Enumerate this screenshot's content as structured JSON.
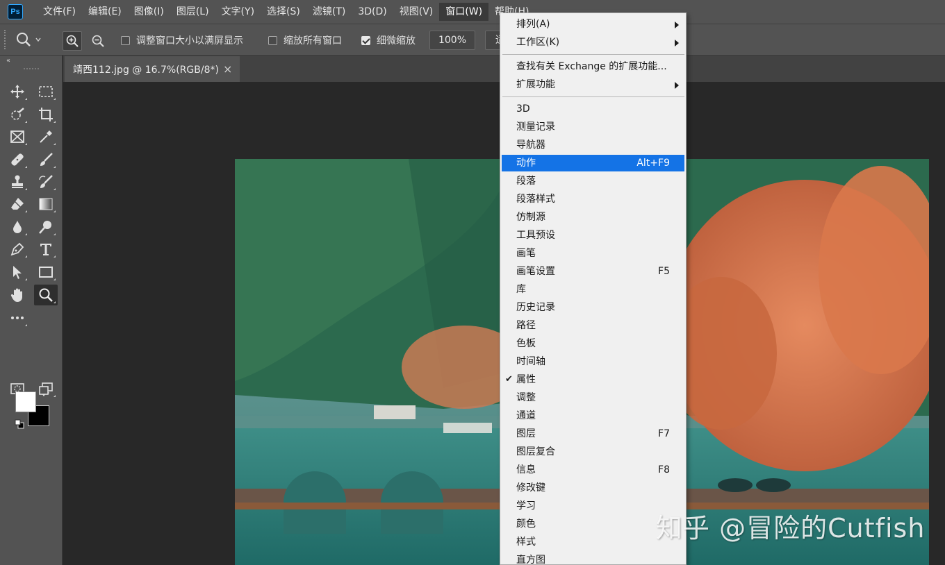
{
  "app": {
    "logo": "Ps"
  },
  "menubar": {
    "items": [
      "文件(F)",
      "编辑(E)",
      "图像(I)",
      "图层(L)",
      "文字(Y)",
      "选择(S)",
      "滤镜(T)",
      "3D(D)",
      "视图(V)",
      "窗口(W)",
      "帮助(H)"
    ],
    "active": "窗口(W)"
  },
  "options": {
    "fit_screen_label": "调整窗口大小以满屏显示",
    "zoom_all_label": "缩放所有窗口",
    "scrubby_label": "细微缩放",
    "scrubby_checked": true,
    "fit_screen_checked": false,
    "zoom_all_checked": false,
    "zoom_value": "100%",
    "next_button_partial": "适"
  },
  "toolbar": {
    "collapse_glyph": "‹‹",
    "tools": [
      "move-tool",
      "marquee-tool",
      "lasso-tool",
      "crop-tool",
      "frame-tool",
      "eyedropper-tool",
      "healing-tool",
      "brush-tool",
      "stamp-tool",
      "history-brush-tool",
      "eraser-tool",
      "gradient-tool",
      "blur-tool",
      "dodge-tool",
      "pen-tool",
      "type-tool",
      "path-select-tool",
      "rectangle-tool",
      "hand-tool",
      "zoom-tool",
      "more-tools",
      "quick-mask",
      "screen-mode"
    ],
    "selected_tool": "zoom-tool",
    "foreground_color": "#ffffff",
    "background_color": "#000000"
  },
  "document": {
    "tab_title": "靖西112.jpg @ 16.7%(RGB/8*)",
    "close_glyph": "×"
  },
  "window_menu": {
    "groups": [
      [
        {
          "label": "排列(A)",
          "submenu": true
        },
        {
          "label": "工作区(K)",
          "submenu": true
        }
      ],
      [
        {
          "label": "查找有关 Exchange 的扩展功能..."
        },
        {
          "label": "扩展功能",
          "submenu": true
        }
      ],
      [
        {
          "label": "3D"
        },
        {
          "label": "测量记录"
        },
        {
          "label": "导航器"
        },
        {
          "label": "动作",
          "shortcut": "Alt+F9",
          "highlighted": true
        },
        {
          "label": "段落"
        },
        {
          "label": "段落样式"
        },
        {
          "label": "仿制源"
        },
        {
          "label": "工具预设"
        },
        {
          "label": "画笔"
        },
        {
          "label": "画笔设置",
          "shortcut": "F5"
        },
        {
          "label": "库"
        },
        {
          "label": "历史记录"
        },
        {
          "label": "路径"
        },
        {
          "label": "色板"
        },
        {
          "label": "时间轴"
        },
        {
          "label": "属性",
          "checked": true
        },
        {
          "label": "调整"
        },
        {
          "label": "通道"
        },
        {
          "label": "图层",
          "shortcut": "F7"
        },
        {
          "label": "图层复合"
        },
        {
          "label": "信息",
          "shortcut": "F8"
        },
        {
          "label": "修改键"
        },
        {
          "label": "学习"
        },
        {
          "label": "颜色"
        },
        {
          "label": "样式"
        },
        {
          "label": "直方图"
        }
      ]
    ]
  },
  "watermark": "知乎 @冒险的Cutfish"
}
